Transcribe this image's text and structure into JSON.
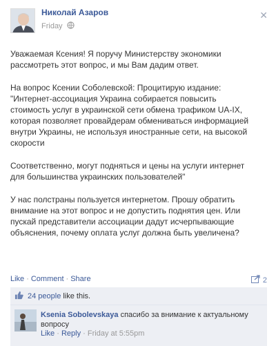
{
  "post": {
    "author": "Николай Азаров",
    "time": "Friday",
    "paragraphs": [
      "Уважаемая Ксения! Я поручу Министерству экономики\nрассмотреть этот вопрос, и мы Вам дадим ответ.",
      "На вопрос Ксении Соболевской: Процитирую издание:\n\"Интернет-ассоциация Украина собирается повысить\nстоимость услуг в украинской сети обмена трафиком UA-IX,\nкоторая позволяет провайдерам обмениваться информацией\nвнутри Украины, не используя иностранные сети, на высокой\nскорости",
      "Соответственно, могут подняться и цены на услуги интернет\nдля большинства украинских пользователей\"",
      "У нас полстраны пользуется интернетом. Прошу обратить\nвнимание на этот вопрос и не допустить поднятия цен. Или\nпускай представители ассоциации дадут исчерпывающие\nобъяснения, почему оплата услуг должна быть увеличена?"
    ]
  },
  "actions": {
    "like": "Like",
    "comment": "Comment",
    "share": "Share",
    "share_count": "2"
  },
  "likes": {
    "count_link": "24 people",
    "suffix": "like this."
  },
  "comment": {
    "author": "Ksenia Sobolevskaya",
    "text": "спасибо за внимание к актуальному\nвопросу",
    "like": "Like",
    "reply": "Reply",
    "time": "Friday at 5:55pm"
  },
  "colors": {
    "link": "#3b5998",
    "ufi_bg": "#edeff4"
  },
  "icons": [
    "close-icon",
    "globe-icon",
    "share-icon",
    "thumbs-up-icon"
  ]
}
